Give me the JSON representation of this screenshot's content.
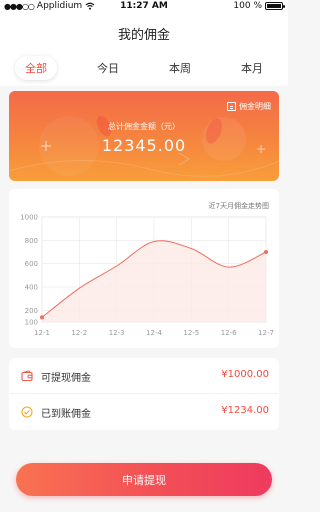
{
  "status_bar": {
    "carrier": "Applidium",
    "time": "11:27 AM",
    "battery": "100 %",
    "battery_level": 1.0
  },
  "header": {
    "title": "我的佣金"
  },
  "tabs": [
    {
      "label": "全部",
      "active": true
    },
    {
      "label": "今日",
      "active": false
    },
    {
      "label": "本周",
      "active": false
    },
    {
      "label": "本月",
      "active": false
    }
  ],
  "summary": {
    "detail_link": "佣金明细",
    "label": "总计佣金金额（元）",
    "amount": "12345.00"
  },
  "chart_title": "近7天月佣金走势图",
  "chart_data": {
    "type": "area",
    "categories": [
      "12-1",
      "12-2",
      "12-3",
      "12-4",
      "12-5",
      "12-6",
      "12-7"
    ],
    "series": [
      {
        "values": [
          140,
          390,
          580,
          790,
          730,
          570,
          700
        ]
      }
    ],
    "y_ticks": [
      100,
      200,
      400,
      600,
      800,
      1000
    ],
    "ylim": [
      100,
      1000
    ],
    "grid": true,
    "colors": {
      "line": "#f26b5b",
      "fill": "#fde8e6",
      "grid": "#e6e6e6"
    }
  },
  "balances": [
    {
      "label": "可提现佣金",
      "value": "¥1000.00",
      "icon": "wallet-icon"
    },
    {
      "label": "已到账佣金",
      "value": "¥1234.00",
      "icon": "check-circle-icon"
    }
  ],
  "actions": {
    "withdraw_label": "申请提现"
  },
  "colors": {
    "accent": "#f14a3e",
    "icon_wallet": "#f25a4a",
    "icon_check": "#f5a623"
  }
}
